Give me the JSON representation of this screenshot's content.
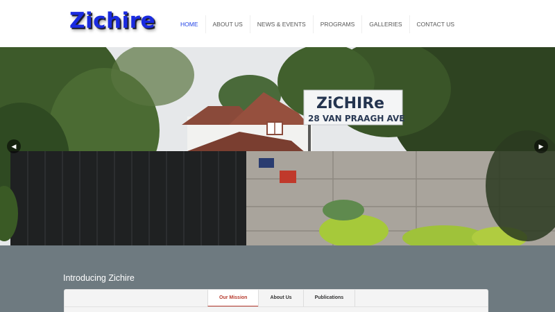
{
  "header": {
    "logo_text": "Zichire",
    "nav": [
      {
        "label": "HOME",
        "active": true
      },
      {
        "label": "ABOUT US",
        "active": false
      },
      {
        "label": "NEWS & EVENTS",
        "active": false
      },
      {
        "label": "PROGRAMS",
        "active": false
      },
      {
        "label": "GALLERIES",
        "active": false
      },
      {
        "label": "CONTACT US",
        "active": false
      }
    ]
  },
  "slider": {
    "sign_line1": "ZiCHIRe",
    "sign_line2": "28 VAN PRAAGH AVE",
    "prev_icon": "chevron-left-icon",
    "next_icon": "chevron-right-icon"
  },
  "intro": {
    "heading": "Introducing Zichire",
    "tabs": [
      {
        "label": "Our Mission",
        "active": true
      },
      {
        "label": "About Us",
        "active": false
      },
      {
        "label": "Publications",
        "active": false
      }
    ]
  },
  "colors": {
    "logo": "#1a2be0",
    "nav_active": "#1e40e6",
    "section_bg": "#6e7a80",
    "tab_active": "#b73b2e"
  }
}
